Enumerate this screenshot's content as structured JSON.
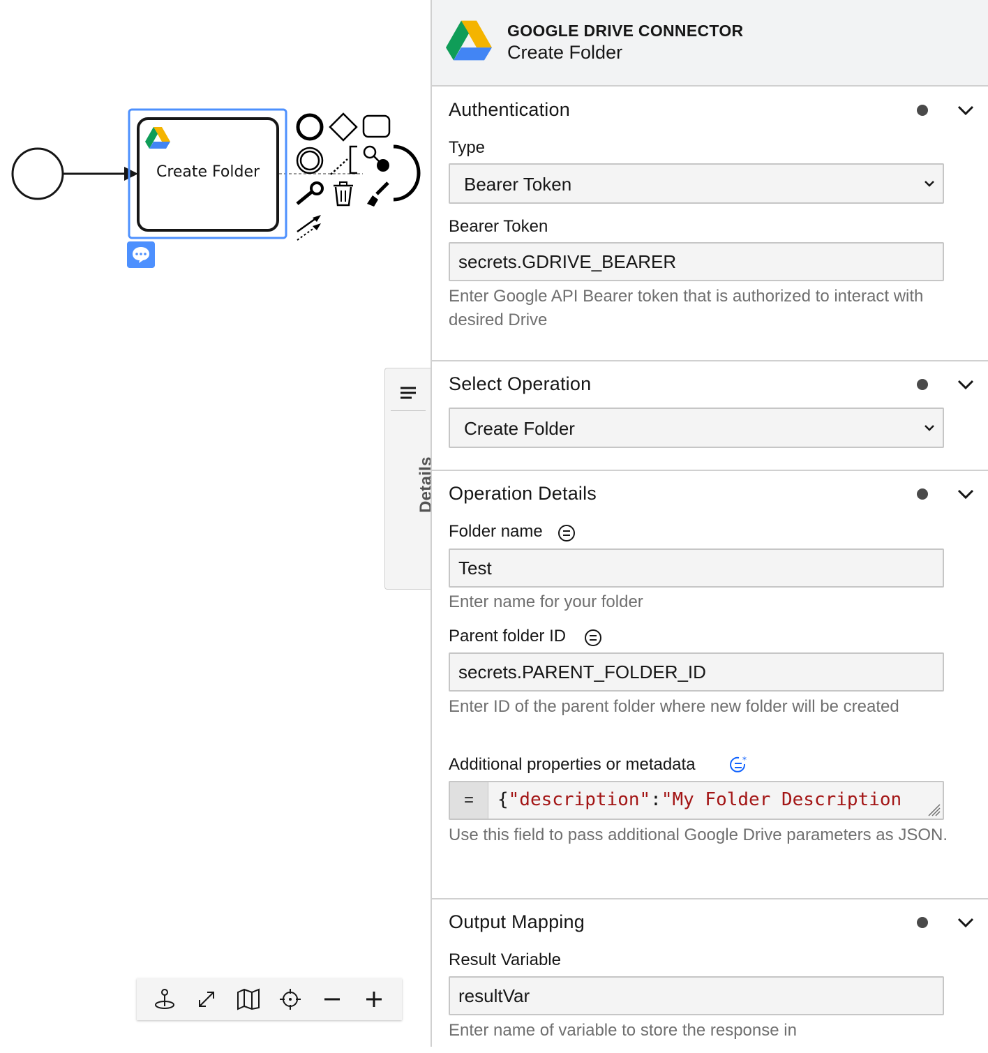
{
  "canvas": {
    "task": {
      "label": "Create Folder"
    }
  },
  "details_tab": {
    "label": "Details"
  },
  "panel": {
    "header": {
      "kicker": "GOOGLE DRIVE CONNECTOR",
      "title": "Create Folder"
    },
    "authentication": {
      "title": "Authentication",
      "type_label": "Type",
      "type_value": "Bearer Token",
      "token_label": "Bearer Token",
      "token_value": "secrets.GDRIVE_BEARER",
      "token_hint": "Enter Google API Bearer token that is authorized to interact with desired Drive"
    },
    "operation": {
      "title": "Select Operation",
      "value": "Create Folder"
    },
    "operation_details": {
      "title": "Operation Details",
      "folder_name_label": "Folder name",
      "folder_name_value": "Test",
      "folder_name_hint": "Enter name for your folder",
      "parent_id_label": "Parent folder ID",
      "parent_id_value": "secrets.PARENT_FOLDER_ID",
      "parent_id_hint": "Enter ID of the parent folder where new folder will be created",
      "additional_label": "Additional properties or metadata",
      "additional_eq": "=",
      "additional_brace": "{",
      "additional_key": "\"description\"",
      "additional_colon": ":",
      "additional_value": "\"My Folder Description",
      "additional_hint": "Use this field to pass additional Google Drive parameters as JSON."
    },
    "output": {
      "title": "Output Mapping",
      "result_label": "Result Variable",
      "result_value": "resultVar",
      "result_hint": "Enter name of variable to store the response in"
    }
  },
  "colors": {
    "selection": "#4d90fe",
    "string": "#a31515",
    "drive_green": "#0f9d58",
    "drive_yellow": "#f4b400",
    "drive_blue": "#4285f4"
  }
}
